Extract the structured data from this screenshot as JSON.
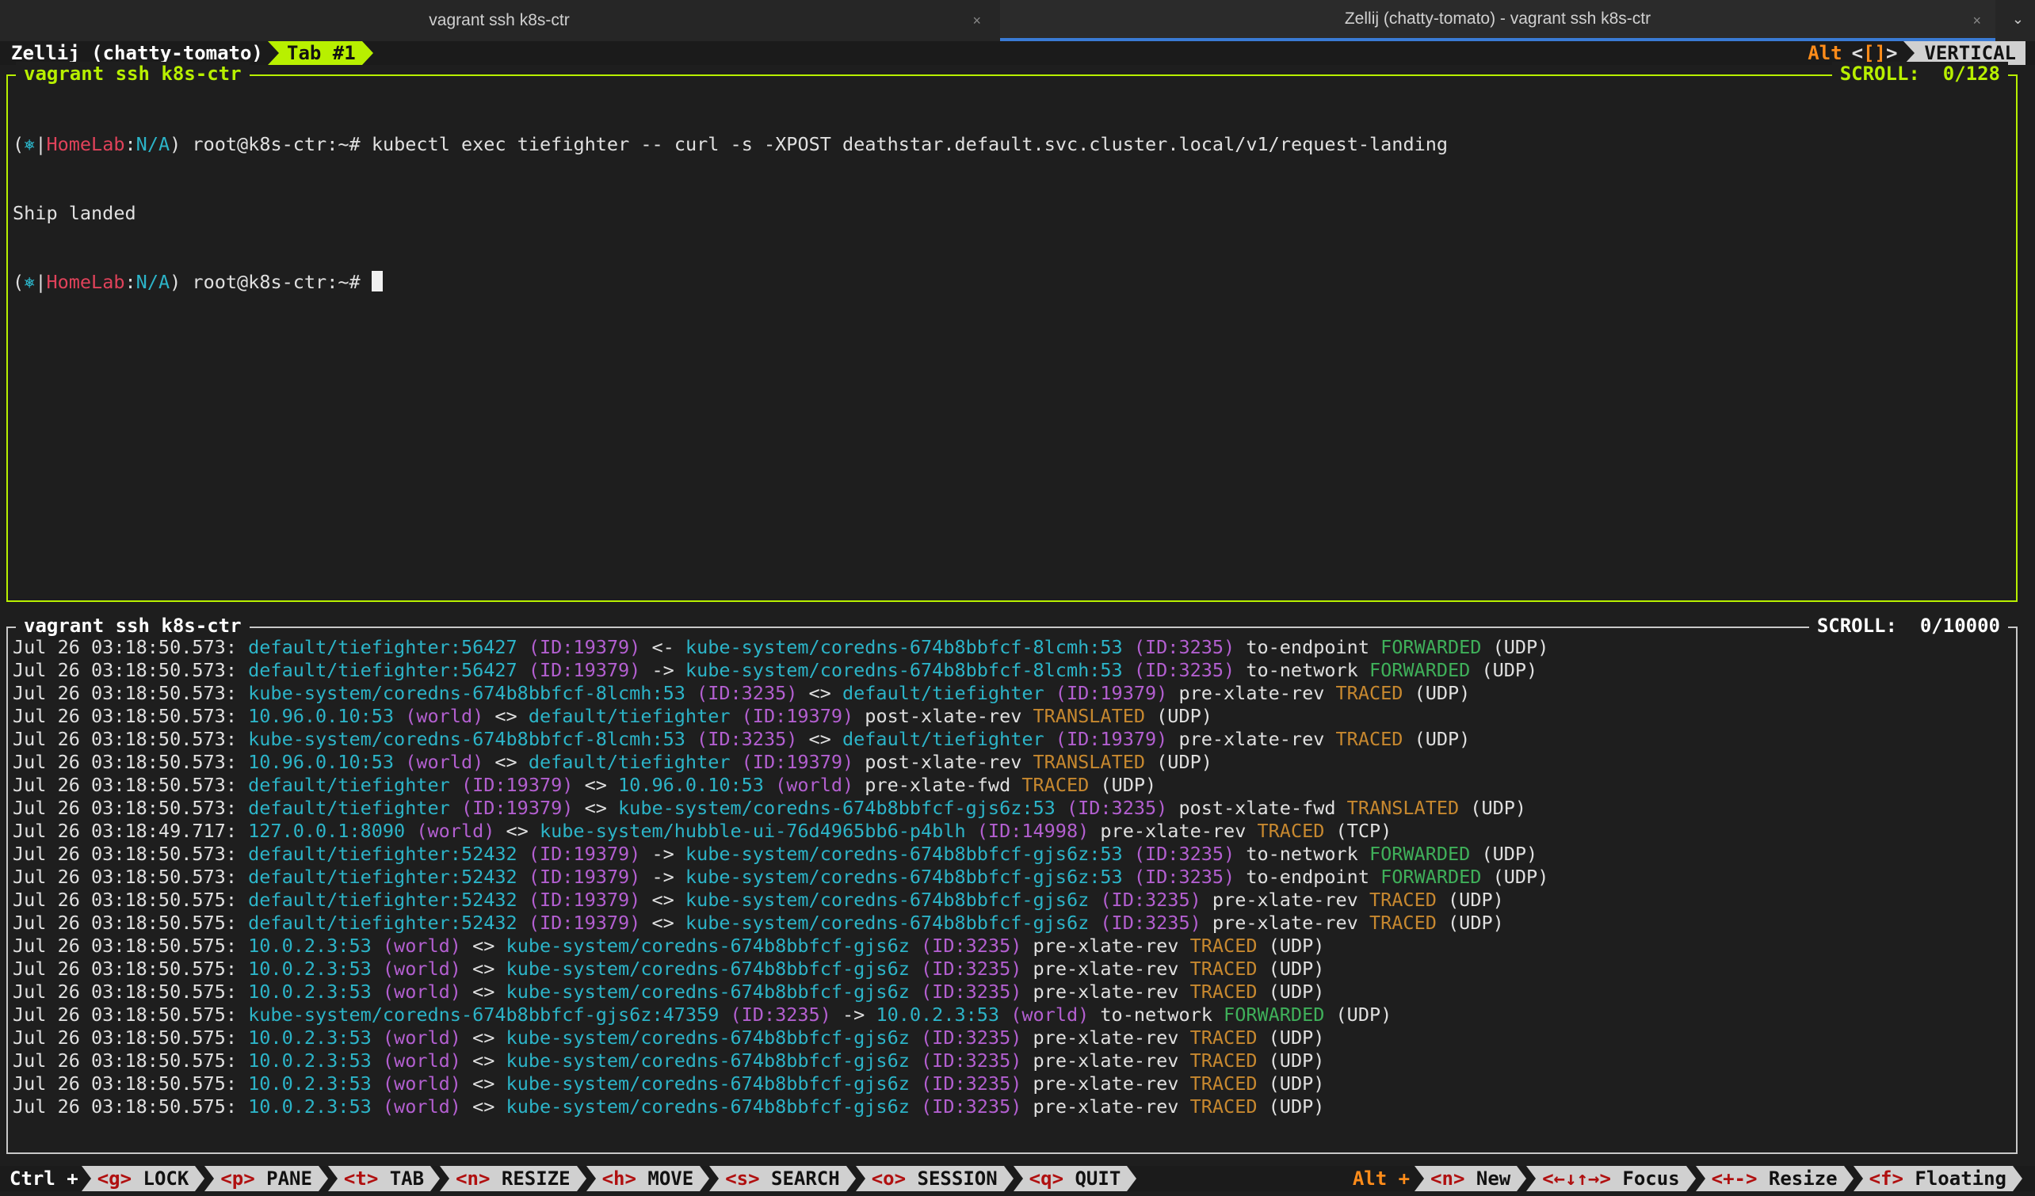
{
  "window_tabs": [
    {
      "title": "vagrant ssh k8s-ctr",
      "active": false
    },
    {
      "title": "Zellij (chatty-tomato) - vagrant ssh k8s-ctr",
      "active": true
    }
  ],
  "icons": {
    "tab_close": "close-icon",
    "tab_menu": "chevron-down-icon"
  },
  "zellij": {
    "session_label": "Zellij (chatty-tomato)",
    "tab_label": "Tab #1",
    "mode_alt": "Alt",
    "mode_lt": "<",
    "mode_brackets": "[]",
    "mode_gt": ">",
    "layout_label": "VERTICAL"
  },
  "pane_top": {
    "title": "vagrant ssh k8s-ctr",
    "scroll": "SCROLL:  0/128",
    "prompt": {
      "open": "(",
      "icon": "⎈",
      "sep": "|",
      "cluster": "HomeLab",
      "colon": ":",
      "ns": "N/A",
      "close": ")",
      "user": " root@k8s-ctr:~# "
    },
    "command": "kubectl exec tiefighter -- curl -s -XPOST deathstar.default.svc.cluster.local/v1/request-landing",
    "output": "Ship landed"
  },
  "pane_bottom": {
    "title": "vagrant ssh k8s-ctr",
    "scroll": "SCROLL:  0/10000",
    "lines": [
      [
        {
          "t": "Jul 26 03:18:50.573: ",
          "c": "white"
        },
        {
          "t": "default/tiefighter:56427",
          "c": "cyan"
        },
        {
          "t": " (ID:19379)",
          "c": "purple"
        },
        {
          "t": " <- ",
          "c": "white"
        },
        {
          "t": "kube-system/coredns-674b8bbfcf-8lcmh:53",
          "c": "cyan"
        },
        {
          "t": " (ID:3235)",
          "c": "purple"
        },
        {
          "t": " to-endpoint ",
          "c": "white"
        },
        {
          "t": "FORWARDED",
          "c": "green"
        },
        {
          "t": " (UDP)",
          "c": "white"
        }
      ],
      [
        {
          "t": "Jul 26 03:18:50.573: ",
          "c": "white"
        },
        {
          "t": "default/tiefighter:56427",
          "c": "cyan"
        },
        {
          "t": " (ID:19379)",
          "c": "purple"
        },
        {
          "t": " -> ",
          "c": "white"
        },
        {
          "t": "kube-system/coredns-674b8bbfcf-8lcmh:53",
          "c": "cyan"
        },
        {
          "t": " (ID:3235)",
          "c": "purple"
        },
        {
          "t": " to-network ",
          "c": "white"
        },
        {
          "t": "FORWARDED",
          "c": "green"
        },
        {
          "t": " (UDP)",
          "c": "white"
        }
      ],
      [
        {
          "t": "Jul 26 03:18:50.573: ",
          "c": "white"
        },
        {
          "t": "kube-system/coredns-674b8bbfcf-8lcmh:53",
          "c": "cyan"
        },
        {
          "t": " (ID:3235)",
          "c": "purple"
        },
        {
          "t": " <> ",
          "c": "white"
        },
        {
          "t": "default/tiefighter",
          "c": "cyan"
        },
        {
          "t": " (ID:19379)",
          "c": "purple"
        },
        {
          "t": " pre-xlate-rev ",
          "c": "white"
        },
        {
          "t": "TRACED",
          "c": "orange"
        },
        {
          "t": " (UDP)",
          "c": "white"
        }
      ],
      [
        {
          "t": "Jul 26 03:18:50.573: ",
          "c": "white"
        },
        {
          "t": "10.96.0.10:53",
          "c": "cyan"
        },
        {
          "t": " (world)",
          "c": "purple"
        },
        {
          "t": " <> ",
          "c": "white"
        },
        {
          "t": "default/tiefighter",
          "c": "cyan"
        },
        {
          "t": " (ID:19379)",
          "c": "purple"
        },
        {
          "t": " post-xlate-rev ",
          "c": "white"
        },
        {
          "t": "TRANSLATED",
          "c": "orange"
        },
        {
          "t": " (UDP)",
          "c": "white"
        }
      ],
      [
        {
          "t": "Jul 26 03:18:50.573: ",
          "c": "white"
        },
        {
          "t": "kube-system/coredns-674b8bbfcf-8lcmh:53",
          "c": "cyan"
        },
        {
          "t": " (ID:3235)",
          "c": "purple"
        },
        {
          "t": " <> ",
          "c": "white"
        },
        {
          "t": "default/tiefighter",
          "c": "cyan"
        },
        {
          "t": " (ID:19379)",
          "c": "purple"
        },
        {
          "t": " pre-xlate-rev ",
          "c": "white"
        },
        {
          "t": "TRACED",
          "c": "orange"
        },
        {
          "t": " (UDP)",
          "c": "white"
        }
      ],
      [
        {
          "t": "Jul 26 03:18:50.573: ",
          "c": "white"
        },
        {
          "t": "10.96.0.10:53",
          "c": "cyan"
        },
        {
          "t": " (world)",
          "c": "purple"
        },
        {
          "t": " <> ",
          "c": "white"
        },
        {
          "t": "default/tiefighter",
          "c": "cyan"
        },
        {
          "t": " (ID:19379)",
          "c": "purple"
        },
        {
          "t": " post-xlate-rev ",
          "c": "white"
        },
        {
          "t": "TRANSLATED",
          "c": "orange"
        },
        {
          "t": " (UDP)",
          "c": "white"
        }
      ],
      [
        {
          "t": "Jul 26 03:18:50.573: ",
          "c": "white"
        },
        {
          "t": "default/tiefighter",
          "c": "cyan"
        },
        {
          "t": " (ID:19379)",
          "c": "purple"
        },
        {
          "t": " <> ",
          "c": "white"
        },
        {
          "t": "10.96.0.10:53",
          "c": "cyan"
        },
        {
          "t": " (world)",
          "c": "purple"
        },
        {
          "t": " pre-xlate-fwd ",
          "c": "white"
        },
        {
          "t": "TRACED",
          "c": "orange"
        },
        {
          "t": " (UDP)",
          "c": "white"
        }
      ],
      [
        {
          "t": "Jul 26 03:18:50.573: ",
          "c": "white"
        },
        {
          "t": "default/tiefighter",
          "c": "cyan"
        },
        {
          "t": " (ID:19379)",
          "c": "purple"
        },
        {
          "t": " <> ",
          "c": "white"
        },
        {
          "t": "kube-system/coredns-674b8bbfcf-gjs6z:53",
          "c": "cyan"
        },
        {
          "t": " (ID:3235)",
          "c": "purple"
        },
        {
          "t": " post-xlate-fwd ",
          "c": "white"
        },
        {
          "t": "TRANSLATED",
          "c": "orange"
        },
        {
          "t": " (UDP)",
          "c": "white"
        }
      ],
      [
        {
          "t": "Jul 26 03:18:49.717: ",
          "c": "white"
        },
        {
          "t": "127.0.0.1:8090",
          "c": "cyan"
        },
        {
          "t": " (world)",
          "c": "purple"
        },
        {
          "t": " <> ",
          "c": "white"
        },
        {
          "t": "kube-system/hubble-ui-76d4965bb6-p4blh",
          "c": "cyan"
        },
        {
          "t": " (ID:14998)",
          "c": "purple"
        },
        {
          "t": " pre-xlate-rev ",
          "c": "white"
        },
        {
          "t": "TRACED",
          "c": "orange"
        },
        {
          "t": " (TCP)",
          "c": "white"
        }
      ],
      [
        {
          "t": "Jul 26 03:18:50.573: ",
          "c": "white"
        },
        {
          "t": "default/tiefighter:52432",
          "c": "cyan"
        },
        {
          "t": " (ID:19379)",
          "c": "purple"
        },
        {
          "t": " -> ",
          "c": "white"
        },
        {
          "t": "kube-system/coredns-674b8bbfcf-gjs6z:53",
          "c": "cyan"
        },
        {
          "t": " (ID:3235)",
          "c": "purple"
        },
        {
          "t": " to-network ",
          "c": "white"
        },
        {
          "t": "FORWARDED",
          "c": "green"
        },
        {
          "t": " (UDP)",
          "c": "white"
        }
      ],
      [
        {
          "t": "Jul 26 03:18:50.573: ",
          "c": "white"
        },
        {
          "t": "default/tiefighter:52432",
          "c": "cyan"
        },
        {
          "t": " (ID:19379)",
          "c": "purple"
        },
        {
          "t": " -> ",
          "c": "white"
        },
        {
          "t": "kube-system/coredns-674b8bbfcf-gjs6z:53",
          "c": "cyan"
        },
        {
          "t": " (ID:3235)",
          "c": "purple"
        },
        {
          "t": " to-endpoint ",
          "c": "white"
        },
        {
          "t": "FORWARDED",
          "c": "green"
        },
        {
          "t": " (UDP)",
          "c": "white"
        }
      ],
      [
        {
          "t": "Jul 26 03:18:50.575: ",
          "c": "white"
        },
        {
          "t": "default/tiefighter:52432",
          "c": "cyan"
        },
        {
          "t": " (ID:19379)",
          "c": "purple"
        },
        {
          "t": " <> ",
          "c": "white"
        },
        {
          "t": "kube-system/coredns-674b8bbfcf-gjs6z",
          "c": "cyan"
        },
        {
          "t": " (ID:3235)",
          "c": "purple"
        },
        {
          "t": " pre-xlate-rev ",
          "c": "white"
        },
        {
          "t": "TRACED",
          "c": "orange"
        },
        {
          "t": " (UDP)",
          "c": "white"
        }
      ],
      [
        {
          "t": "Jul 26 03:18:50.575: ",
          "c": "white"
        },
        {
          "t": "default/tiefighter:52432",
          "c": "cyan"
        },
        {
          "t": " (ID:19379)",
          "c": "purple"
        },
        {
          "t": " <> ",
          "c": "white"
        },
        {
          "t": "kube-system/coredns-674b8bbfcf-gjs6z",
          "c": "cyan"
        },
        {
          "t": " (ID:3235)",
          "c": "purple"
        },
        {
          "t": " pre-xlate-rev ",
          "c": "white"
        },
        {
          "t": "TRACED",
          "c": "orange"
        },
        {
          "t": " (UDP)",
          "c": "white"
        }
      ],
      [
        {
          "t": "Jul 26 03:18:50.575: ",
          "c": "white"
        },
        {
          "t": "10.0.2.3:53",
          "c": "cyan"
        },
        {
          "t": " (world)",
          "c": "purple"
        },
        {
          "t": " <> ",
          "c": "white"
        },
        {
          "t": "kube-system/coredns-674b8bbfcf-gjs6z",
          "c": "cyan"
        },
        {
          "t": " (ID:3235)",
          "c": "purple"
        },
        {
          "t": " pre-xlate-rev ",
          "c": "white"
        },
        {
          "t": "TRACED",
          "c": "orange"
        },
        {
          "t": " (UDP)",
          "c": "white"
        }
      ],
      [
        {
          "t": "Jul 26 03:18:50.575: ",
          "c": "white"
        },
        {
          "t": "10.0.2.3:53",
          "c": "cyan"
        },
        {
          "t": " (world)",
          "c": "purple"
        },
        {
          "t": " <> ",
          "c": "white"
        },
        {
          "t": "kube-system/coredns-674b8bbfcf-gjs6z",
          "c": "cyan"
        },
        {
          "t": " (ID:3235)",
          "c": "purple"
        },
        {
          "t": " pre-xlate-rev ",
          "c": "white"
        },
        {
          "t": "TRACED",
          "c": "orange"
        },
        {
          "t": " (UDP)",
          "c": "white"
        }
      ],
      [
        {
          "t": "Jul 26 03:18:50.575: ",
          "c": "white"
        },
        {
          "t": "10.0.2.3:53",
          "c": "cyan"
        },
        {
          "t": " (world)",
          "c": "purple"
        },
        {
          "t": " <> ",
          "c": "white"
        },
        {
          "t": "kube-system/coredns-674b8bbfcf-gjs6z",
          "c": "cyan"
        },
        {
          "t": " (ID:3235)",
          "c": "purple"
        },
        {
          "t": " pre-xlate-rev ",
          "c": "white"
        },
        {
          "t": "TRACED",
          "c": "orange"
        },
        {
          "t": " (UDP)",
          "c": "white"
        }
      ],
      [
        {
          "t": "Jul 26 03:18:50.575: ",
          "c": "white"
        },
        {
          "t": "kube-system/coredns-674b8bbfcf-gjs6z:47359",
          "c": "cyan"
        },
        {
          "t": " (ID:3235)",
          "c": "purple"
        },
        {
          "t": " -> ",
          "c": "white"
        },
        {
          "t": "10.0.2.3:53",
          "c": "cyan"
        },
        {
          "t": " (world)",
          "c": "purple"
        },
        {
          "t": " to-network ",
          "c": "white"
        },
        {
          "t": "FORWARDED",
          "c": "green"
        },
        {
          "t": " (UDP)",
          "c": "white"
        }
      ],
      [
        {
          "t": "Jul 26 03:18:50.575: ",
          "c": "white"
        },
        {
          "t": "10.0.2.3:53",
          "c": "cyan"
        },
        {
          "t": " (world)",
          "c": "purple"
        },
        {
          "t": " <> ",
          "c": "white"
        },
        {
          "t": "kube-system/coredns-674b8bbfcf-gjs6z",
          "c": "cyan"
        },
        {
          "t": " (ID:3235)",
          "c": "purple"
        },
        {
          "t": " pre-xlate-rev ",
          "c": "white"
        },
        {
          "t": "TRACED",
          "c": "orange"
        },
        {
          "t": " (UDP)",
          "c": "white"
        }
      ],
      [
        {
          "t": "Jul 26 03:18:50.575: ",
          "c": "white"
        },
        {
          "t": "10.0.2.3:53",
          "c": "cyan"
        },
        {
          "t": " (world)",
          "c": "purple"
        },
        {
          "t": " <> ",
          "c": "white"
        },
        {
          "t": "kube-system/coredns-674b8bbfcf-gjs6z",
          "c": "cyan"
        },
        {
          "t": " (ID:3235)",
          "c": "purple"
        },
        {
          "t": " pre-xlate-rev ",
          "c": "white"
        },
        {
          "t": "TRACED",
          "c": "orange"
        },
        {
          "t": " (UDP)",
          "c": "white"
        }
      ],
      [
        {
          "t": "Jul 26 03:18:50.575: ",
          "c": "white"
        },
        {
          "t": "10.0.2.3:53",
          "c": "cyan"
        },
        {
          "t": " (world)",
          "c": "purple"
        },
        {
          "t": " <> ",
          "c": "white"
        },
        {
          "t": "kube-system/coredns-674b8bbfcf-gjs6z",
          "c": "cyan"
        },
        {
          "t": " (ID:3235)",
          "c": "purple"
        },
        {
          "t": " pre-xlate-rev ",
          "c": "white"
        },
        {
          "t": "TRACED",
          "c": "orange"
        },
        {
          "t": " (UDP)",
          "c": "white"
        }
      ],
      [
        {
          "t": "Jul 26 03:18:50.575: ",
          "c": "white"
        },
        {
          "t": "10.0.2.3:53",
          "c": "cyan"
        },
        {
          "t": " (world)",
          "c": "purple"
        },
        {
          "t": " <> ",
          "c": "white"
        },
        {
          "t": "kube-system/coredns-674b8bbfcf-gjs6z",
          "c": "cyan"
        },
        {
          "t": " (ID:3235)",
          "c": "purple"
        },
        {
          "t": " pre-xlate-rev ",
          "c": "white"
        },
        {
          "t": "TRACED",
          "c": "orange"
        },
        {
          "t": " (UDP)",
          "c": "white"
        }
      ]
    ]
  },
  "status_bar": {
    "ctrl_label": "Ctrl +",
    "ctrl_keys": [
      {
        "key": "<g>",
        "label": " LOCK"
      },
      {
        "key": "<p>",
        "label": " PANE"
      },
      {
        "key": "<t>",
        "label": " TAB"
      },
      {
        "key": "<n>",
        "label": " RESIZE"
      },
      {
        "key": "<h>",
        "label": " MOVE"
      },
      {
        "key": "<s>",
        "label": " SEARCH"
      },
      {
        "key": "<o>",
        "label": " SESSION"
      },
      {
        "key": "<q>",
        "label": " QUIT"
      }
    ],
    "alt_label": "Alt +",
    "alt_keys": [
      {
        "key": "<n>",
        "label": " New"
      },
      {
        "key": "<←↓↑→>",
        "label": " Focus"
      },
      {
        "key": "<+->",
        "label": " Resize"
      },
      {
        "key": "<f>",
        "label": " Floating"
      }
    ]
  }
}
